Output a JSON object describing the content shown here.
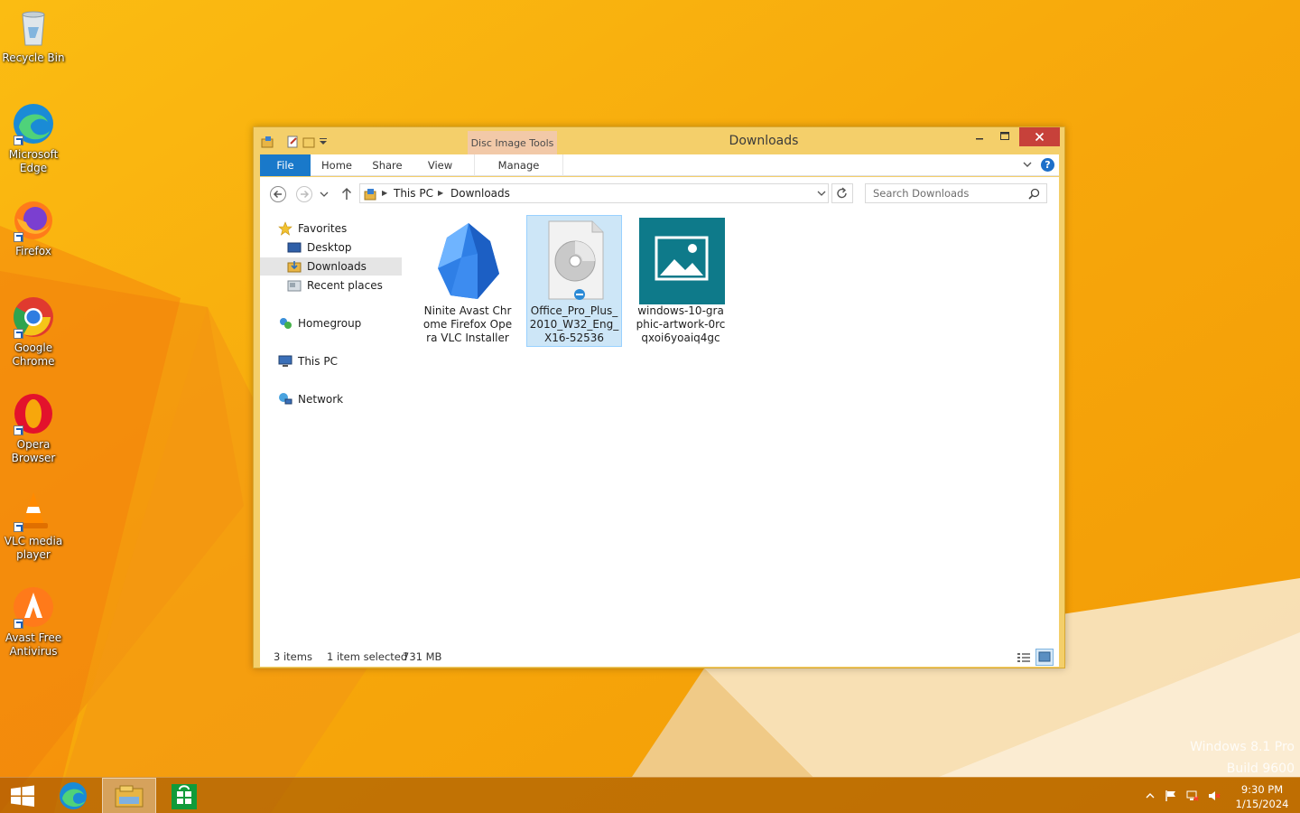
{
  "desktop": {
    "icons": [
      {
        "label": "Recycle Bin"
      },
      {
        "label": "Microsoft Edge"
      },
      {
        "label": "Firefox"
      },
      {
        "label": "Google Chrome"
      },
      {
        "label": "Opera Browser"
      },
      {
        "label": "VLC media player"
      },
      {
        "label": "Avast Free Antivirus"
      }
    ],
    "watermark": {
      "line1": "Windows 8.1 Pro",
      "line2": "Build 9600"
    }
  },
  "window": {
    "title": "Downloads",
    "contextual_tab_group": "Disc Image Tools",
    "ribbon_tabs": {
      "file": "File",
      "home": "Home",
      "share": "Share",
      "view": "View",
      "manage": "Manage"
    },
    "help_label": "?",
    "address": {
      "crumbs": [
        "This PC",
        "Downloads"
      ]
    },
    "search": {
      "placeholder": "Search Downloads"
    },
    "nav": {
      "favorites": "Favorites",
      "desktop": "Desktop",
      "downloads": "Downloads",
      "recent": "Recent places",
      "homegroup": "Homegroup",
      "thispc": "This PC",
      "network": "Network"
    },
    "files": [
      {
        "name": "Ninite Avast Chrome Firefox Opera VLC Installer",
        "icon": "ninite-icon",
        "selected": false
      },
      {
        "name": "Office_Pro_Plus_2010_W32_Eng_X16-52536",
        "icon": "disc-image-icon",
        "selected": true
      },
      {
        "name": "windows-10-graphic-artwork-0rcqxoi6yoaiq4gc",
        "icon": "image-file-icon",
        "selected": false
      }
    ],
    "status": {
      "count": "3 items",
      "selected": "1 item selected",
      "size": "731 MB"
    }
  },
  "taskbar": {
    "clock_time": "9:30 PM",
    "clock_date": "1/15/2024"
  },
  "colors": {
    "accent": "#1979ca",
    "window_frame": "#f4cf6a",
    "close_button": "#c7413a",
    "selection": "#cde6f7"
  }
}
